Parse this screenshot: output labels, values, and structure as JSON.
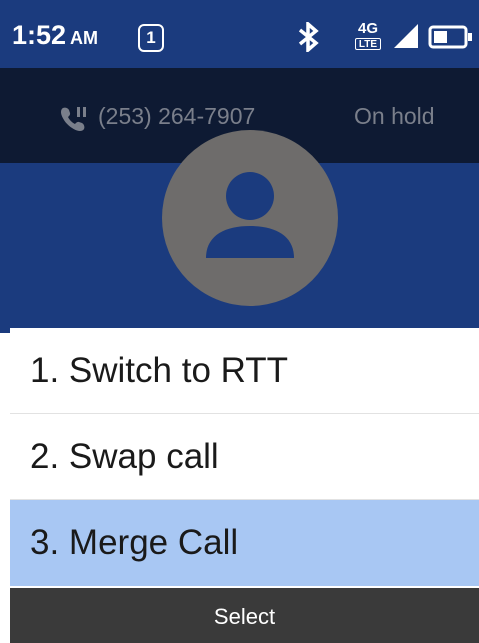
{
  "status_bar": {
    "time": "1:52",
    "ampm": "AM",
    "sim_slot": "1",
    "network_top": "4G",
    "network_bottom": "LTE",
    "icons": [
      "bluetooth-icon",
      "network-4g-lte-icon",
      "signal-icon",
      "battery-icon"
    ]
  },
  "call": {
    "phone_number": "(253) 264-7907",
    "status": "On hold",
    "icons": [
      "phone-hold-icon",
      "avatar-person-icon"
    ]
  },
  "menu": {
    "items": [
      {
        "label": "1. Switch to RTT",
        "selected": false
      },
      {
        "label": "2. Swap call",
        "selected": false
      },
      {
        "label": "3. Merge Call",
        "selected": true
      }
    ]
  },
  "softkeys": {
    "center": "Select"
  },
  "colors": {
    "status_bar_bg": "#1b3b7e",
    "call_header_bg": "#0e1a33",
    "avatar_bg": "#6e6c6b",
    "avatar_person": "#1b3b7e",
    "selected_item_bg": "#a8c7f3",
    "softkey_bg": "#3a3a3a",
    "muted_text": "#7a7f8b"
  }
}
